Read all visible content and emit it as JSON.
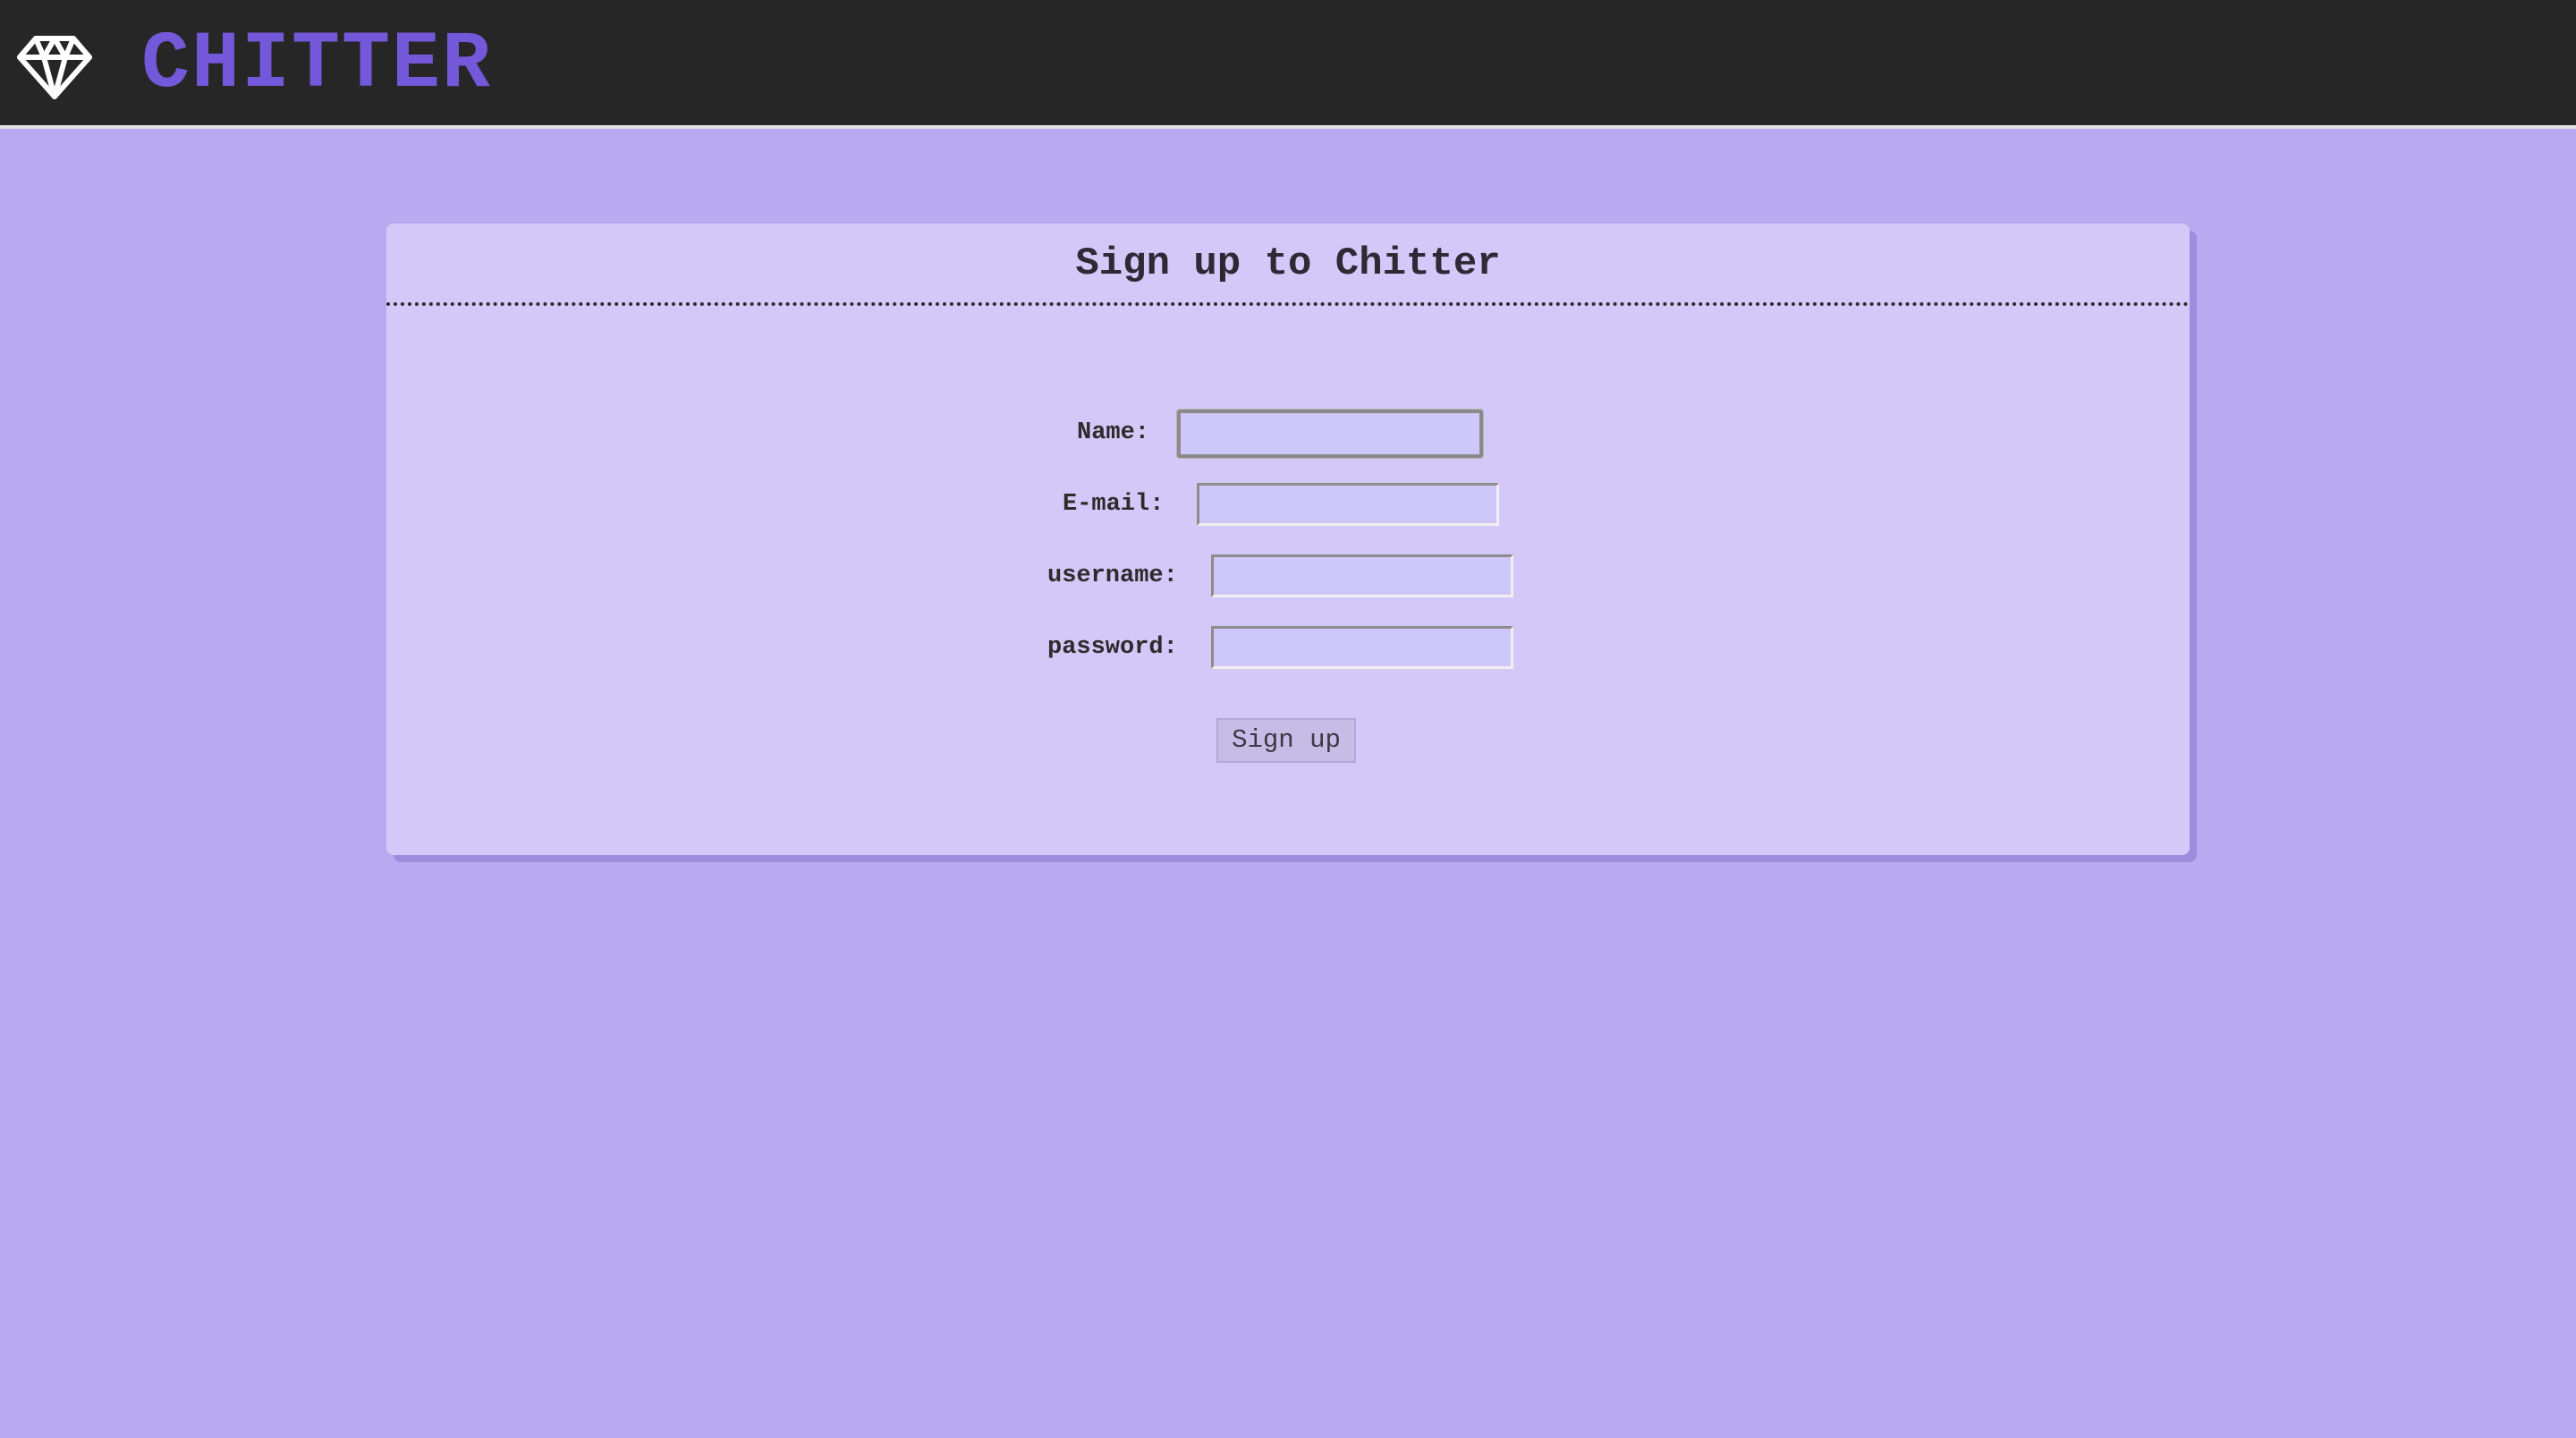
{
  "header": {
    "brand": "CHITTER",
    "logo_icon": "diamond-icon",
    "background_color": "#262626",
    "brand_color": "#7458da"
  },
  "page": {
    "background_color": "#b8a9f1"
  },
  "signup_form": {
    "title": "Sign up to Chitter",
    "fields": [
      {
        "label": "Name:",
        "value": "",
        "focused": true
      },
      {
        "label": "E-mail:",
        "value": ""
      },
      {
        "label": "username:",
        "value": ""
      },
      {
        "label": "password:",
        "value": ""
      }
    ],
    "submit_label": "Sign up",
    "card_color": "#d4c8f8",
    "input_color": "#cdc8f9"
  }
}
